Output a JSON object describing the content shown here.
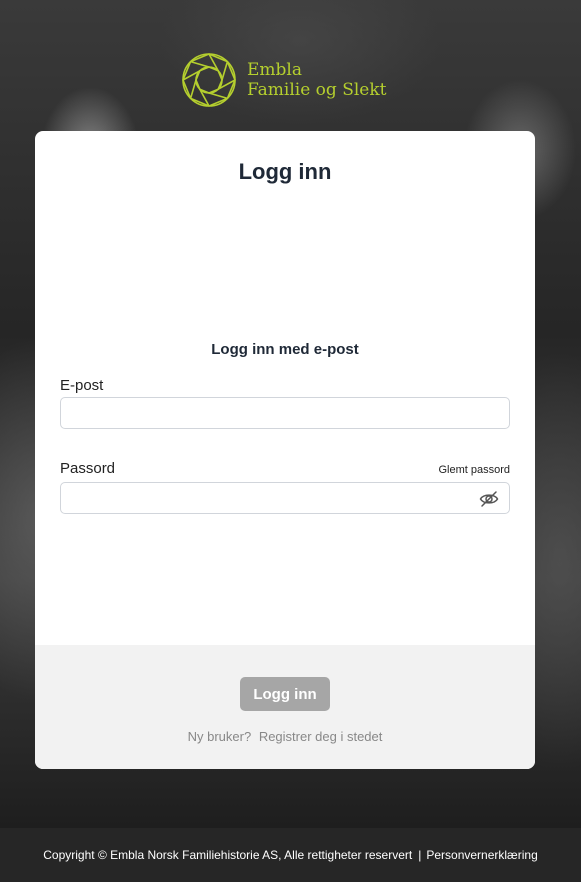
{
  "brand": {
    "line1": "Embla",
    "line2": "Familie og Slekt",
    "color": "#b5cf2e"
  },
  "card": {
    "title": "Logg inn",
    "subtitle": "Logg inn med e-post",
    "email": {
      "label": "E-post",
      "value": "",
      "placeholder": ""
    },
    "password": {
      "label": "Passord",
      "value": "",
      "placeholder": "",
      "forgot_label": "Glemt passord",
      "toggle_icon": "eye-slash-icon"
    },
    "submit_label": "Logg inn",
    "register_prompt": "Ny bruker?",
    "register_link": "Registrer deg i stedet"
  },
  "footer": {
    "copyright": "Copyright © Embla Norsk Familiehistorie AS, Alle rettigheter reservert",
    "separator": "|",
    "privacy_link": "Personvernerklæring"
  }
}
